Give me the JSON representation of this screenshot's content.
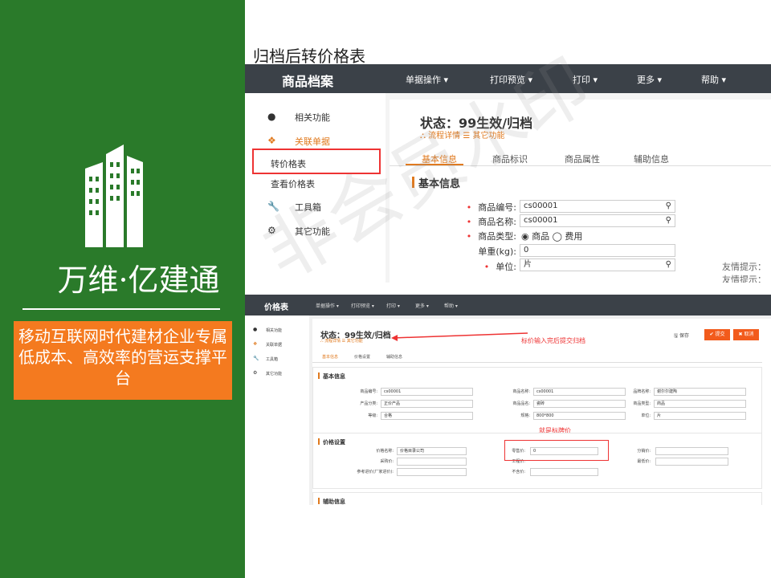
{
  "brand": {
    "name": "万维·亿建通",
    "slogan": "移动互联网时代建材企业专属低成本、高效率的营运支撑平台",
    "colors": {
      "panel": "#2a7a2a",
      "slogan_bg": "#f47a1f"
    }
  },
  "slide_title": "归档后转价格表",
  "watermark": "非会员水印",
  "shot1": {
    "app_title": "商品档案",
    "menu": [
      "单据操作 ▾",
      "打印预览 ▾",
      "打印 ▾",
      "更多 ▾",
      "帮助 ▾"
    ],
    "sidebar": [
      {
        "icon": "info-icon",
        "glyph": "●",
        "label": "相关功能"
      },
      {
        "icon": "dropbox-icon",
        "glyph": "❖",
        "label": "关联单据"
      },
      {
        "icon": "",
        "glyph": "",
        "label": "转价格表"
      },
      {
        "icon": "",
        "glyph": "",
        "label": "查看价格表"
      },
      {
        "icon": "wrench-icon",
        "glyph": "🔧",
        "label": "工具箱"
      },
      {
        "icon": "gears-icon",
        "glyph": "⚙",
        "label": "其它功能"
      }
    ],
    "status": "状态：99生效/归档",
    "sublinks": "⛬ 流程详情   ☰ 其它功能",
    "tabs": [
      "基本信息",
      "商品标识",
      "商品属性",
      "辅助信息"
    ],
    "section": "基本信息",
    "fields": [
      {
        "label": "商品编号:",
        "value": "cs00001",
        "required": true
      },
      {
        "label": "商品名称:",
        "value": "cs00001",
        "required": true
      },
      {
        "label": "商品类型:",
        "value": "◉ 商品  ◯ 费用",
        "required": true
      },
      {
        "label": "单重(kg):",
        "value": "0",
        "required": false
      },
      {
        "label": "单位:",
        "value": "片",
        "required": true
      }
    ],
    "hints": [
      "友情提示：",
      "友情提示："
    ]
  },
  "shot2": {
    "app_title": "价格表",
    "menu": [
      "单据操作 ▾",
      "打印预览 ▾",
      "打印 ▾",
      "更多 ▾",
      "帮助 ▾"
    ],
    "sidebar": [
      {
        "glyph": "●",
        "label": "相关功能"
      },
      {
        "glyph": "❖",
        "label": "关联单据"
      },
      {
        "glyph": "🔧",
        "label": "工具箱"
      },
      {
        "glyph": "⚙",
        "label": "其它功能"
      }
    ],
    "status": "状态：99生效/归档",
    "sublinks": "⛬ 流程详情  ☰ 其它功能",
    "annotation_submit": "标价输入完后提交归档",
    "annotation_price": "就是标牌价",
    "buttons": {
      "save": "🖫 保存",
      "submit": "✔ 提交",
      "cancel": "✖ 取消"
    },
    "tabs": [
      "基本信息",
      "价格设置",
      "辅助信息"
    ],
    "sections": {
      "basic": "基本信息",
      "price": "价格设置",
      "aux": "辅助信息"
    },
    "basic_fields": [
      {
        "label": "商品编号:",
        "value": "cs00001"
      },
      {
        "label": "商品名称:",
        "value": "cs00001"
      },
      {
        "label": "品牌名称:",
        "value": "谢尔尔建陶"
      },
      {
        "label": "产品分类:",
        "value": "正价产品"
      },
      {
        "label": "商品品名:",
        "value": "瓷砖"
      },
      {
        "label": "商品类型:",
        "value": "商品"
      },
      {
        "label": "等级:",
        "value": "合格"
      },
      {
        "label": "规格:",
        "value": "800*800"
      },
      {
        "label": "单位:",
        "value": "片"
      }
    ],
    "price_fields": [
      {
        "label": "价格名称:",
        "value": "价格目录公司"
      },
      {
        "label": "零售价:",
        "value": "0"
      },
      {
        "label": "分销价:",
        "value": ""
      },
      {
        "label": "采购价:",
        "value": ""
      },
      {
        "label": "工程价:",
        "value": ""
      },
      {
        "label": "最低价:",
        "value": ""
      },
      {
        "label": "参考进价(厂家进价):",
        "value": ""
      },
      {
        "label": "不含价:",
        "value": ""
      }
    ]
  }
}
